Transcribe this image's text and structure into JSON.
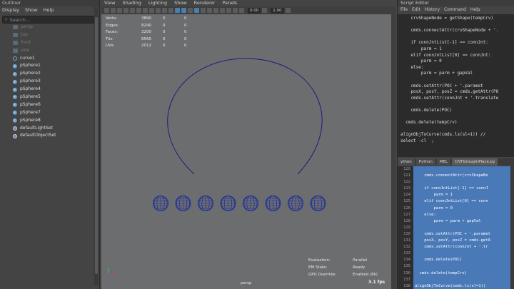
{
  "outliner": {
    "title": "Outliner",
    "menu": [
      "Display",
      "Show",
      "Help"
    ],
    "search_placeholder": "Search...",
    "items": [
      {
        "label": "persp",
        "type": "camera",
        "dim": true
      },
      {
        "label": "top",
        "type": "camera",
        "dim": true
      },
      {
        "label": "front",
        "type": "camera",
        "dim": true
      },
      {
        "label": "side",
        "type": "camera",
        "dim": true
      },
      {
        "label": "curve1",
        "type": "curve",
        "dim": false
      },
      {
        "label": "pSphere1",
        "type": "sphere",
        "dim": false
      },
      {
        "label": "pSphere2",
        "type": "sphere",
        "dim": false
      },
      {
        "label": "pSphere3",
        "type": "sphere",
        "dim": false
      },
      {
        "label": "pSphere4",
        "type": "sphere",
        "dim": false
      },
      {
        "label": "pSphere5",
        "type": "sphere",
        "dim": false
      },
      {
        "label": "pSphere6",
        "type": "sphere",
        "dim": false
      },
      {
        "label": "pSphere7",
        "type": "sphere",
        "dim": false
      },
      {
        "label": "pSphere8",
        "type": "sphere",
        "dim": false
      },
      {
        "label": "defaultLightSet",
        "type": "set",
        "dim": false
      },
      {
        "label": "defaultObjectSet",
        "type": "set",
        "dim": false
      }
    ]
  },
  "viewport": {
    "menu": [
      "View",
      "Shading",
      "Lighting",
      "Show",
      "Renderer",
      "Panels"
    ],
    "toolbar_values": [
      "0.00",
      "1.00"
    ],
    "stats": [
      {
        "label": "Verts:",
        "v1": "3890",
        "v2": "0",
        "v3": "0"
      },
      {
        "label": "Edges:",
        "v1": "8240",
        "v2": "0",
        "v3": "0"
      },
      {
        "label": "Faces:",
        "v1": "3200",
        "v2": "0",
        "v3": "0"
      },
      {
        "label": "Tris:",
        "v1": "6560",
        "v2": "0",
        "v3": "0"
      },
      {
        "label": "UVs:",
        "v1": "2012",
        "v2": "0",
        "v3": "0"
      }
    ],
    "hud": [
      {
        "label": "Evaluation:",
        "value": "Parallel"
      },
      {
        "label": "EM State:",
        "value": "Ready"
      },
      {
        "label": "GPU Override:",
        "value": "Enabled (8k)"
      }
    ],
    "camera": "persp",
    "fps": "3.1 fps",
    "colors": {
      "curve": "#1e1e7a",
      "sphere": "#1f2f9a",
      "background": "#6c6d6f"
    }
  },
  "script_editor": {
    "title": "Script Editor",
    "menu": [
      "File",
      "Edit",
      "History",
      "Command",
      "Help"
    ],
    "history_lines": [
      "    crvShapeNode = getShape(tempCrv)",
      "",
      "    cmds.connectAttr(crvShapeNode + '.",
      "",
      "    if connJntList[-1] == connJnt:",
      "        parm = 1",
      "    elif connJntList[0] == connJnt:",
      "        parm = 0",
      "    else:",
      "        parm = parm + gapVal",
      "",
      "    cmds.setAttr(POC + '.paramet",
      "    posX, posY, posZ = cmds.getAttr(PO",
      "    cmds.setAttr(connJnt + '.translate",
      "",
      "    cmds.delete(POC)",
      "",
      "  cmds.delete(tempCrv)",
      "",
      "alignObjToCurve(cmds.ls(sl=1)) //",
      "select -cl  ;"
    ],
    "tabs": [
      "ython",
      "Python",
      "MEL",
      "CNTGroupInPlace.py"
    ],
    "editor_lines": [
      {
        "num": "120",
        "code": "",
        "hl": true
      },
      {
        "num": "121",
        "code": "    cmds.connectAttr(crvShapeNo",
        "hl": true
      },
      {
        "num": "122",
        "code": "",
        "hl": true
      },
      {
        "num": "123",
        "code": "    if connJntList[-1] == connJ",
        "hl": true
      },
      {
        "num": "124",
        "code": "        parm = 1",
        "hl": true
      },
      {
        "num": "125",
        "code": "    elif connJntList[0] == conn",
        "hl": true
      },
      {
        "num": "126",
        "code": "        parm = 0",
        "hl": true
      },
      {
        "num": "127",
        "code": "    else:",
        "hl": true
      },
      {
        "num": "128",
        "code": "        parm = parm + gapVal",
        "hl": true
      },
      {
        "num": "129",
        "code": "",
        "hl": true
      },
      {
        "num": "130",
        "code": "    cmds.setAttr(POC + '.paramet",
        "hl": true
      },
      {
        "num": "131",
        "code": "    posX, posY, posZ = cmds.getA",
        "hl": true
      },
      {
        "num": "132",
        "code": "    cmds.setAttr(connJnt + '.tr",
        "hl": true
      },
      {
        "num": "133",
        "code": "",
        "hl": true
      },
      {
        "num": "134",
        "code": "    cmds.delete(POC)",
        "hl": true
      },
      {
        "num": "135",
        "code": "",
        "hl": true
      },
      {
        "num": "136",
        "code": "  cmds.delete(tempCrv)",
        "hl": true
      },
      {
        "num": "137",
        "code": "",
        "hl": true
      },
      {
        "num": "138",
        "code": "alignObjToCurve(cmds.ls(sl=1))",
        "hl": true
      }
    ]
  }
}
